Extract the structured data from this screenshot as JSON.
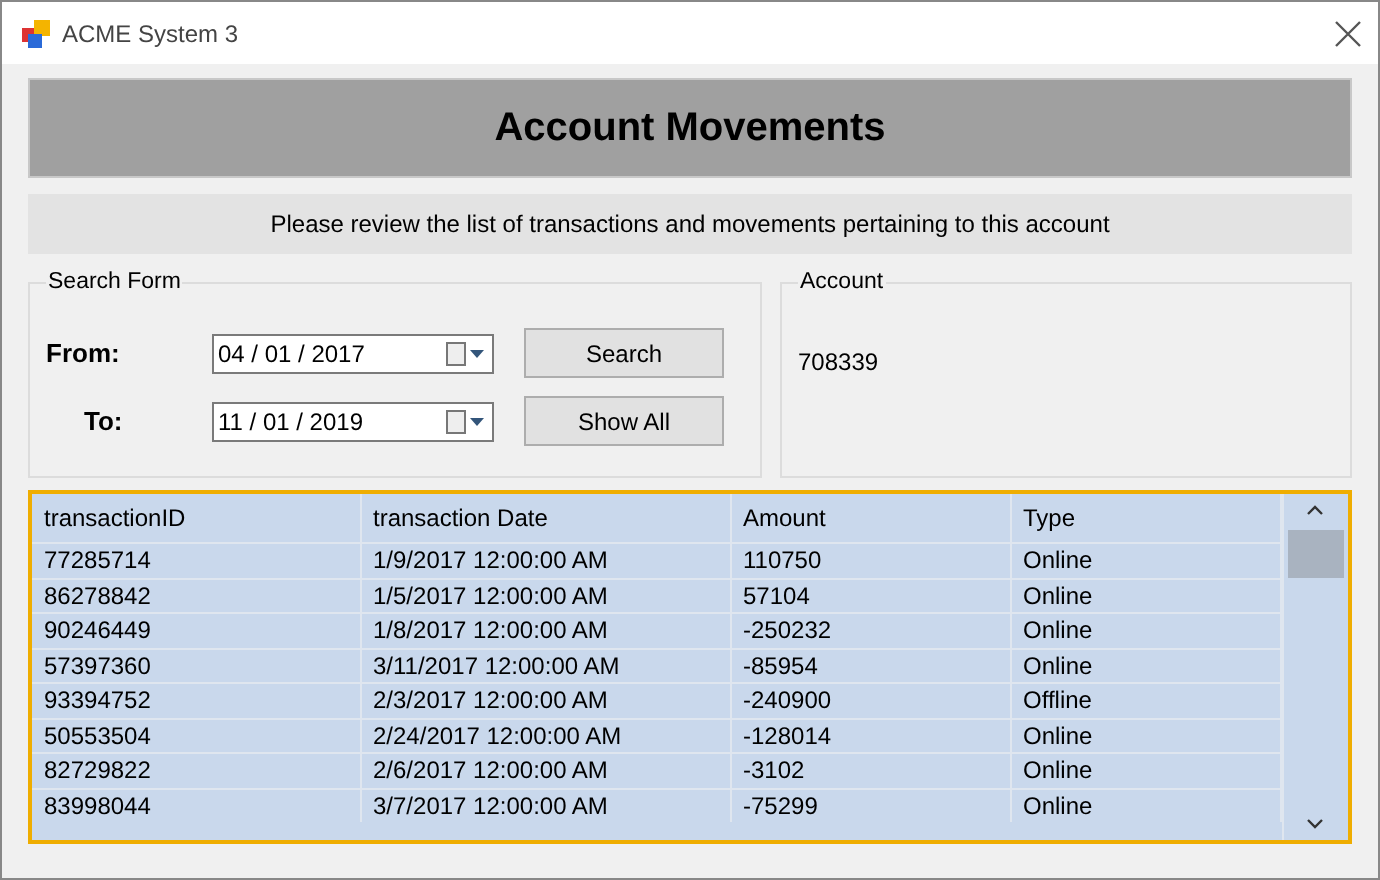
{
  "window": {
    "title": "ACME System 3"
  },
  "header": {
    "title": "Account Movements",
    "subtitle": "Please review the list of transactions and movements pertaining to this account"
  },
  "search_form": {
    "legend": "Search Form",
    "from_label": "From:",
    "from_value": "04 / 01 / 2017",
    "to_label": "To:",
    "to_value": "11 / 01 / 2019",
    "buttons": [
      "Search",
      "Show All"
    ]
  },
  "account": {
    "legend": "Account",
    "value": "708339"
  },
  "table": {
    "columns": [
      "transactionID",
      "transaction Date",
      "Amount",
      "Type"
    ],
    "rows": [
      [
        "77285714",
        "1/9/2017 12:00:00 AM",
        "110750",
        "Online"
      ],
      [
        "86278842",
        "1/5/2017 12:00:00 AM",
        "57104",
        "Online"
      ],
      [
        "90246449",
        "1/8/2017 12:00:00 AM",
        "-250232",
        "Online"
      ],
      [
        "57397360",
        "3/11/2017 12:00:00 AM",
        "-85954",
        "Online"
      ],
      [
        "93394752",
        "2/3/2017 12:00:00 AM",
        "-240900",
        "Offline"
      ],
      [
        "50553504",
        "2/24/2017 12:00:00 AM",
        "-128014",
        "Online"
      ],
      [
        "82729822",
        "2/6/2017 12:00:00 AM",
        "-3102",
        "Online"
      ],
      [
        "83998044",
        "3/7/2017 12:00:00 AM",
        "-75299",
        "Online"
      ]
    ]
  }
}
